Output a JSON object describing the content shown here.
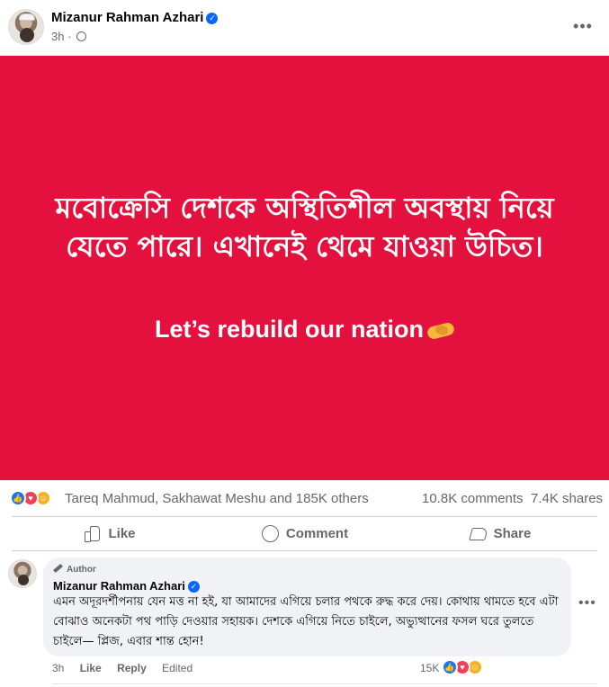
{
  "post": {
    "author": "Mizanur Rahman Azhari",
    "time": "3h",
    "privacy_icon": "globe-icon",
    "more_icon": "more-options-icon",
    "image": {
      "background_color": "#e4103d",
      "bangla_text": "মবোক্রেসি দেশকে অস্থিতিশীল অবস্থায় নিয়ে যেতে পারে। এখানেই থেমে যাওয়া উচিত।",
      "english_text": "Let’s rebuild our nation",
      "emoji": "handshake-icon"
    },
    "summary": {
      "reaction_icons": [
        "like-icon",
        "love-icon",
        "care-icon"
      ],
      "reactors": "Tareq Mahmud, Sakhawat Meshu and 185K others",
      "comments": "10.8K comments",
      "shares": "7.4K shares"
    },
    "actions": {
      "like": "Like",
      "comment": "Comment",
      "share": "Share"
    }
  },
  "comment": {
    "badge": "Author",
    "name": "Mizanur Rahman Azhari",
    "text": "এমন অদূরদর্শীপনায় যেন মত্ত না হই, যা আমাদের এগিয়ে চলার পথকে রুদ্ধ করে দেয়। কোথায় থামতে হবে এটা বোঝাও অনেকটা পথ পাড়ি দেওয়ার সহায়ক। দেশকে এগিয়ে নিতে চাইলে, অভ্যুত্থানের ফসল ঘরে তুলতে চাইলে— প্লিজ, এবার শান্ত হোন!",
    "time": "3h",
    "like": "Like",
    "reply": "Reply",
    "edited": "Edited",
    "reaction_count": "15K",
    "reaction_icons": [
      "like-icon",
      "love-icon",
      "care-icon"
    ]
  },
  "colors": {
    "accent": "#0866ff",
    "like": "#1877f2",
    "love": "#f33e58",
    "care": "#f7b125"
  }
}
